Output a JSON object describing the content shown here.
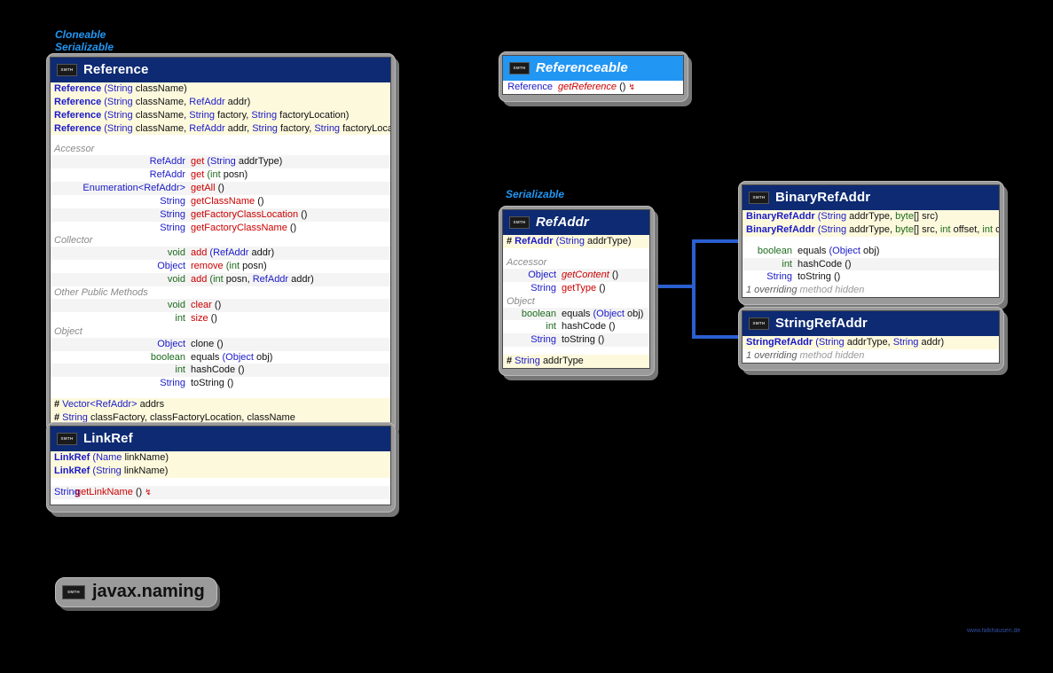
{
  "page": {
    "watermark": "www.falkhausen.de",
    "package_label": "javax.naming",
    "badge_text": "SMTH",
    "accent_blue": "#2196f3",
    "header_blue": "#0d2a72",
    "ctor_bg": "#fdf9dd"
  },
  "stereotypes": {
    "reference": "Cloneable\nSerializable",
    "reference_line1": "Cloneable",
    "reference_line2": "Serializable",
    "refaddr": "Serializable"
  },
  "classes": {
    "reference": {
      "name": "Reference",
      "constructors": [
        {
          "vis": "",
          "name": "Reference",
          "params": "(String className)"
        },
        {
          "vis": "",
          "name": "Reference",
          "params": "(String className, RefAddr addr)"
        },
        {
          "vis": "",
          "name": "Reference",
          "params": "(String className, String factory, String factoryLocation)"
        },
        {
          "vis": "",
          "name": "Reference",
          "params": "(String className, RefAddr addr, String factory, String factoryLocation)"
        }
      ],
      "groups": [
        {
          "label": "Accessor",
          "methods": [
            {
              "ret": "RefAddr",
              "name": "get",
              "params": "(String addrType)"
            },
            {
              "ret": "RefAddr",
              "name": "get",
              "params": "(int posn)"
            },
            {
              "ret": "Enumeration<RefAddr>",
              "name": "getAll",
              "params": "()"
            },
            {
              "ret": "String",
              "name": "getClassName",
              "params": "()"
            },
            {
              "ret": "String",
              "name": "getFactoryClassLocation",
              "params": "()"
            },
            {
              "ret": "String",
              "name": "getFactoryClassName",
              "params": "()"
            }
          ]
        },
        {
          "label": "Collector",
          "methods": [
            {
              "ret": "void",
              "name": "add",
              "params": "(RefAddr addr)"
            },
            {
              "ret": "Object",
              "name": "remove",
              "params": "(int posn)"
            },
            {
              "ret": "void",
              "name": "add",
              "params": "(int posn, RefAddr addr)"
            }
          ]
        },
        {
          "label": "Other Public Methods",
          "methods": [
            {
              "ret": "void",
              "name": "clear",
              "params": "()"
            },
            {
              "ret": "int",
              "name": "size",
              "params": "()"
            }
          ]
        },
        {
          "label": "Object",
          "methods": [
            {
              "ret": "Object",
              "name": "clone",
              "params": "()"
            },
            {
              "ret": "boolean",
              "name": "equals",
              "params": "(Object obj)"
            },
            {
              "ret": "int",
              "name": "hashCode",
              "params": "()"
            },
            {
              "ret": "String",
              "name": "toString",
              "params": "()"
            }
          ]
        }
      ],
      "fields": [
        {
          "vis": "#",
          "type": "Vector<RefAddr>",
          "names": "addrs"
        },
        {
          "vis": "#",
          "type": "String",
          "names": "classFactory, classFactoryLocation, className"
        }
      ]
    },
    "linkref": {
      "name": "LinkRef",
      "constructors": [
        {
          "vis": "",
          "name": "LinkRef",
          "params": "(Name linkName)"
        },
        {
          "vis": "",
          "name": "LinkRef",
          "params": "(String linkName)"
        }
      ],
      "groups": [
        {
          "label": "",
          "methods": [
            {
              "ret": "String",
              "name": "getLinkName",
              "params": "()",
              "throws": true
            }
          ]
        }
      ],
      "fields": []
    },
    "referenceable": {
      "name": "Referenceable",
      "is_interface": true,
      "methods": [
        {
          "ret": "Reference",
          "name": "getReference",
          "params": "()",
          "abstract": true,
          "throws": true
        }
      ]
    },
    "refaddr": {
      "name": "RefAddr",
      "abstract": true,
      "constructors": [
        {
          "vis": "#",
          "name": "RefAddr",
          "params": "(String addrType)"
        }
      ],
      "groups": [
        {
          "label": "Accessor",
          "methods": [
            {
              "ret": "Object",
              "name": "getContent",
              "params": "()",
              "abstract": true
            },
            {
              "ret": "String",
              "name": "getType",
              "params": "()"
            }
          ]
        },
        {
          "label": "Object",
          "methods": [
            {
              "ret": "boolean",
              "name": "equals",
              "params": "(Object obj)"
            },
            {
              "ret": "int",
              "name": "hashCode",
              "params": "()"
            },
            {
              "ret": "String",
              "name": "toString",
              "params": "()"
            }
          ]
        }
      ],
      "fields": [
        {
          "vis": "#",
          "type": "String",
          "names": "addrType"
        }
      ]
    },
    "binaryrefaddr": {
      "name": "BinaryRefAddr",
      "constructors": [
        {
          "vis": "",
          "name": "BinaryRefAddr",
          "params": "(String addrType, byte[] src)"
        },
        {
          "vis": "",
          "name": "BinaryRefAddr",
          "params": "(String addrType, byte[] src, int offset, int count)"
        }
      ],
      "methods": [
        {
          "ret": "boolean",
          "name": "equals",
          "params": "(Object obj)"
        },
        {
          "ret": "int",
          "name": "hashCode",
          "params": "()"
        },
        {
          "ret": "String",
          "name": "toString",
          "params": "()"
        }
      ],
      "hidden_note_num": "1 overriding",
      "hidden_note_rest": "method hidden"
    },
    "stringrefaddr": {
      "name": "StringRefAddr",
      "constructors": [
        {
          "vis": "",
          "name": "StringRefAddr",
          "params": "(String addrType, String addr)"
        }
      ],
      "methods": [],
      "hidden_note_num": "1 overriding",
      "hidden_note_rest": "method hidden"
    }
  }
}
